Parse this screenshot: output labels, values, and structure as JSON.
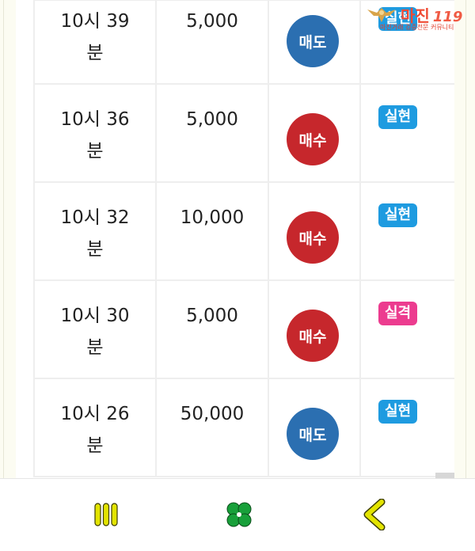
{
  "logo": {
    "brand": "마진",
    "badge_number": "119",
    "tagline": "마진거래 검증전문 커뮤니티"
  },
  "rows": [
    {
      "time_line1": "10시 39",
      "time_line2": "분",
      "amount": "5,000",
      "action": "매도",
      "result": "실현"
    },
    {
      "time_line1": "10시 36",
      "time_line2": "분",
      "amount": "5,000",
      "action": "매수",
      "result": "실현"
    },
    {
      "time_line1": "10시 32",
      "time_line2": "분",
      "amount": "10,000",
      "action": "매수",
      "result": "실현"
    },
    {
      "time_line1": "10시 30",
      "time_line2": "분",
      "amount": "5,000",
      "action": "매수",
      "result": "실격"
    },
    {
      "time_line1": "10시 26",
      "time_line2": "분",
      "amount": "50,000",
      "action": "매도",
      "result": "실현"
    }
  ],
  "colors": {
    "sell": "#2b6fb1",
    "buy": "#c6272c",
    "result_hit": "#1e9be0",
    "result_miss": "#ec3c8f",
    "nav_icon": "#e3e400",
    "nav_clover": "#18a03a"
  },
  "bottom_nav": {
    "icons": [
      "menu-bars-icon",
      "clover-icon",
      "back-chevron-icon"
    ]
  }
}
